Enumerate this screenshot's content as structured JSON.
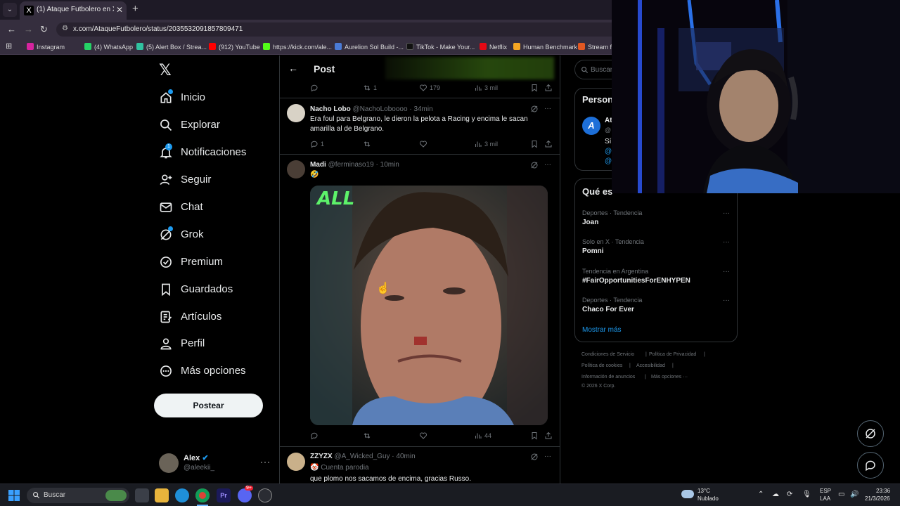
{
  "browser": {
    "tab_title": "(1) Ataque Futbolero en X: \"😂",
    "tab_favicon": "X",
    "url": "x.com/AtaqueFutbolero/status/2035532091857809471",
    "bookmarks": [
      {
        "label": "Instagram",
        "color": "#d6249f"
      },
      {
        "label": "(4) WhatsApp",
        "color": "#25d366"
      },
      {
        "label": "(5) Alert Box / Strea...",
        "color": "#30c3a0"
      },
      {
        "label": "(912) YouTube",
        "color": "#ff0000"
      },
      {
        "label": "https://kick.com/ale...",
        "color": "#53fc18"
      },
      {
        "label": "Aurelion Sol Build -...",
        "color": "#4a7bd6"
      },
      {
        "label": "TikTok - Make Your...",
        "color": "#111111"
      },
      {
        "label": "Netflix",
        "color": "#e50914"
      },
      {
        "label": "Human Benchmark",
        "color": "#f5a623"
      },
      {
        "label": "Stream fr",
        "color": "#e25822"
      }
    ]
  },
  "sidebar": {
    "logo": "𝕏",
    "items": [
      {
        "label": "Inicio",
        "icon": "home-icon"
      },
      {
        "label": "Explorar",
        "icon": "search-icon"
      },
      {
        "label": "Notificaciones",
        "icon": "bell-icon",
        "badge": "1"
      },
      {
        "label": "Seguir",
        "icon": "follow-icon"
      },
      {
        "label": "Chat",
        "icon": "mail-icon"
      },
      {
        "label": "Grok",
        "icon": "grok-icon"
      },
      {
        "label": "Premium",
        "icon": "verified-icon"
      },
      {
        "label": "Guardados",
        "icon": "bookmark-icon"
      },
      {
        "label": "Artículos",
        "icon": "article-icon"
      },
      {
        "label": "Perfil",
        "icon": "person-icon"
      },
      {
        "label": "Más opciones",
        "icon": "more-circle-icon"
      }
    ],
    "post_button": "Postear",
    "account": {
      "name": "Alex",
      "handle": "@aleekii_",
      "more": "···"
    }
  },
  "main": {
    "header_title": "Post",
    "top_actions": {
      "replies": "",
      "reposts": "1",
      "likes": "179",
      "views": "3 mil"
    },
    "tweets": [
      {
        "name": "Nacho Lobo",
        "handle": "@NachoLoboooo · 34min",
        "text": "Era foul para Belgrano, le dieron la pelota a Racing y encima le sacan amarilla al de Belgrano.",
        "replies": "1",
        "reposts": "",
        "likes": "",
        "views": "3 mil"
      },
      {
        "name": "Madi",
        "handle": "@ferminaso19 · 10min",
        "text": "🤣",
        "media_tag": "ALL",
        "replies": "",
        "reposts": "",
        "likes": "",
        "views": "44"
      },
      {
        "name": "ZZYZX",
        "handle": "@A_Wicked_Guy · 40min",
        "sub": "🤡 Cuenta parodia",
        "text": "que plomo nos sacamos de encima, gracias Russo."
      }
    ]
  },
  "right": {
    "search_placeholder": "Buscar",
    "persons_title": "Person",
    "persons_user": "At",
    "persons_user_handle": "@",
    "persons_bio": "Sí",
    "persons_mention_1": "@",
    "persons_mention_2": "@",
    "trends_title": "Qué es",
    "trends": [
      {
        "meta": "Deportes · Tendencia",
        "name": "Joan"
      },
      {
        "meta": "Solo en X · Tendencia",
        "name": "Pomni"
      },
      {
        "meta": "Tendencia en Argentina",
        "name": "#FairOpportunitiesForENHYPEN"
      },
      {
        "meta": "Deportes · Tendencia",
        "name": "Chaco For Ever"
      }
    ],
    "show_more": "Mostrar más",
    "footer": [
      "Condiciones de Servicio",
      "|",
      "Política de Privacidad",
      "|",
      "Política de cookies",
      "|",
      "Accesibilidad",
      "|",
      "Información de anuncios",
      "|",
      "Más opciones ···",
      "© 2026 X Corp."
    ]
  },
  "taskbar": {
    "search": "Buscar",
    "weather_temp": "13°C",
    "weather_desc": "Nublado",
    "lang_1": "ESP",
    "lang_2": "LAA",
    "time": "23:36",
    "date": "21/3/2026",
    "discord_badge": "9+"
  }
}
